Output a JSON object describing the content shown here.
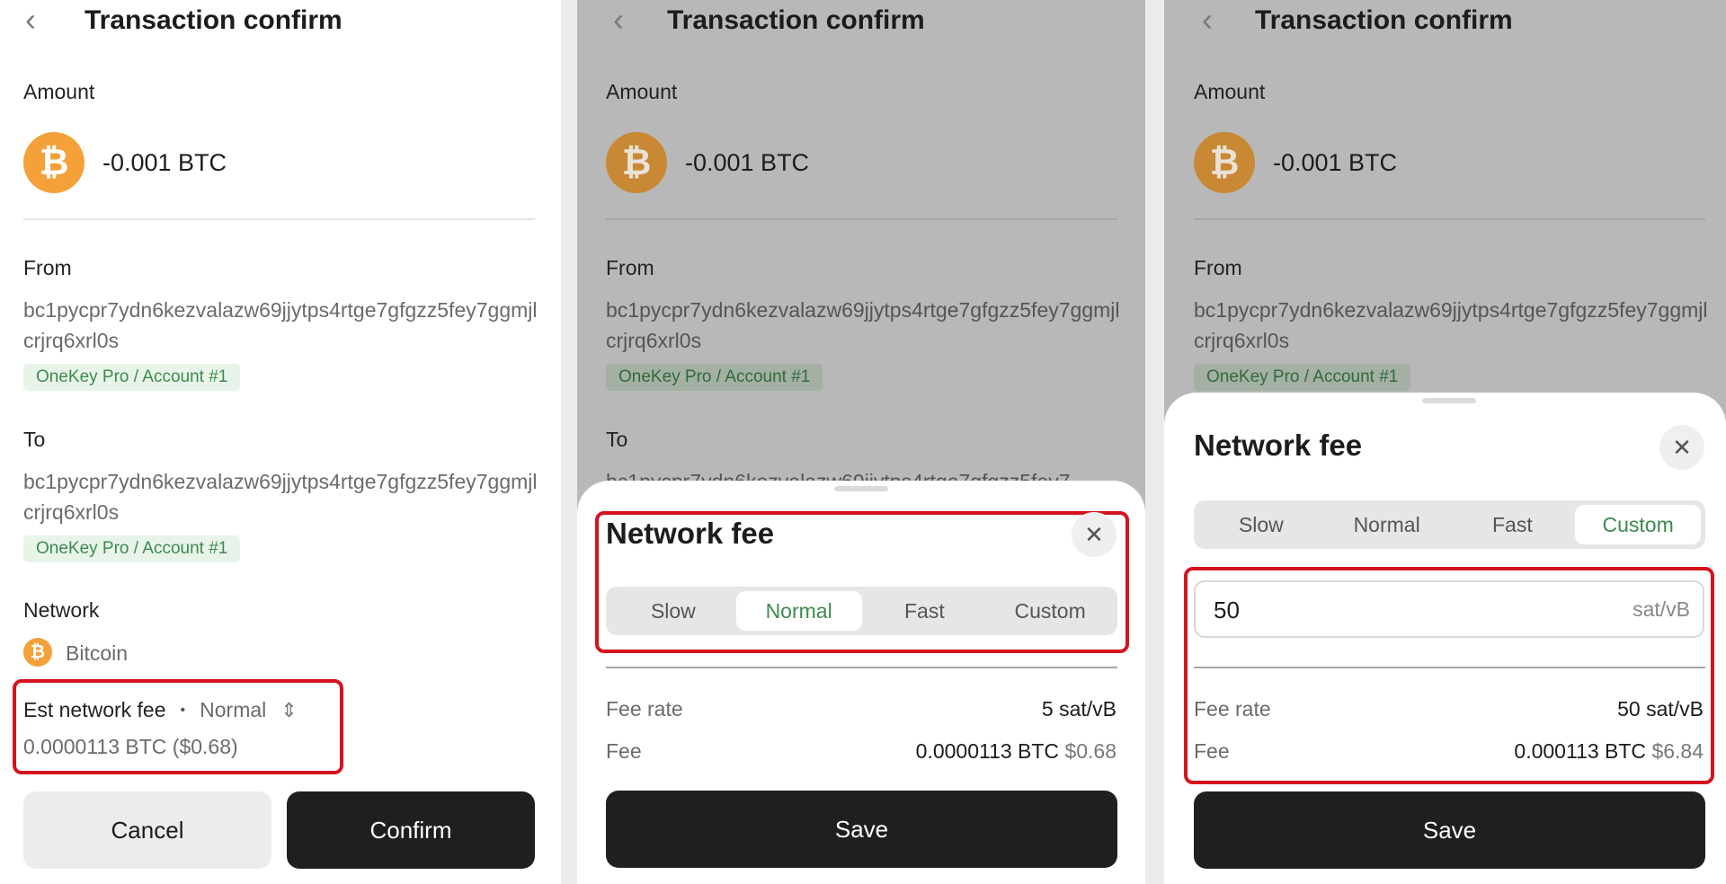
{
  "screen": {
    "title": "Transaction confirm",
    "amount_label": "Amount",
    "amount_value": "-0.001 BTC",
    "from_label": "From",
    "from_address": "bc1pycpr7ydn6kezvalazw69jjytps4rtge7gfgzz5fey7ggmjlcrjrq6xrl0s",
    "from_account": "OneKey Pro / Account #1",
    "to_label": "To",
    "to_address": "bc1pycpr7ydn6kezvalazw69jjytps4rtge7gfgzz5fey7ggmjlcrjrq6xrl0s",
    "to_account": "OneKey Pro / Account #1",
    "to_partial_text": "bc1pycpr7ydn6kezvalazw69jjytps4rtge7gfgzz5fey7",
    "network_label": "Network",
    "network_value": "Bitcoin",
    "est_fee_label": "Est network fee",
    "est_fee_dot": "•",
    "est_fee_speed": "Normal",
    "est_fee_value": "0.0000113 BTC ($0.68)",
    "cancel_label": "Cancel",
    "confirm_label": "Confirm"
  },
  "icons": {
    "back": "chevron-left-icon",
    "coin": "bitcoin-icon",
    "selector": "up-down-chevron-icon",
    "close": "close-icon"
  },
  "icon_glyphs": {
    "back": "‹",
    "bitcoin": "₿",
    "selector": "⇕",
    "close": "✕"
  },
  "fee_sheet": {
    "title": "Network fee",
    "options": [
      "Slow",
      "Normal",
      "Fast",
      "Custom"
    ],
    "normal": {
      "selected": "Normal",
      "fee_rate_label": "Fee rate",
      "fee_rate_value": "5 sat/vB",
      "fee_label": "Fee",
      "fee_btc": "0.0000113 BTC",
      "fee_usd": "$0.68"
    },
    "custom": {
      "selected": "Custom",
      "input_value": "50",
      "input_unit": "sat/vB",
      "fee_rate_label": "Fee rate",
      "fee_rate_value": "50 sat/vB",
      "fee_label": "Fee",
      "fee_btc": "0.000113 BTC",
      "fee_usd": "$6.84"
    },
    "save_label": "Save"
  },
  "colors": {
    "accent_green": "#3d8a4e",
    "highlight_red": "#d4131e",
    "bitcoin_orange": "#f5a13a",
    "dark_button": "#1f1f1f"
  }
}
